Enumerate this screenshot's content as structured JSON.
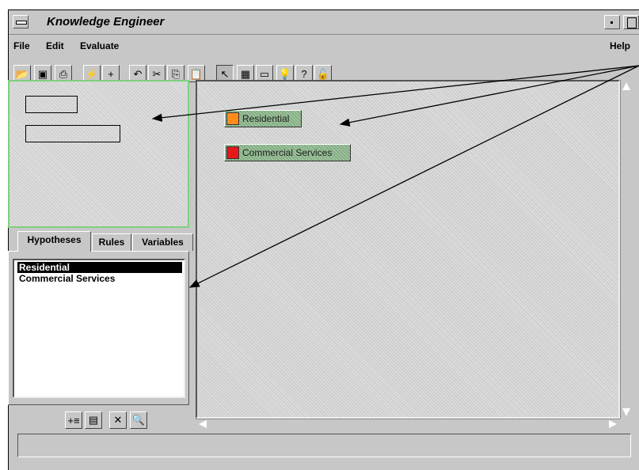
{
  "window": {
    "title": "Knowledge Engineer"
  },
  "menubar": {
    "file": "File",
    "edit": "Edit",
    "evaluate": "Evaluate",
    "help": "Help"
  },
  "toolbar": {
    "buttons": [
      {
        "name": "open-icon",
        "glyph": "📂"
      },
      {
        "name": "save-icon",
        "glyph": "▣"
      },
      {
        "name": "print-icon",
        "glyph": "⎙"
      },
      {
        "name": "connect-icon",
        "glyph": "⚡"
      },
      {
        "name": "add-icon",
        "glyph": "+"
      },
      {
        "name": "undo-icon",
        "glyph": "↶"
      },
      {
        "name": "cut-icon",
        "glyph": "✂"
      },
      {
        "name": "copy-icon",
        "glyph": "⎘"
      },
      {
        "name": "paste-icon",
        "glyph": "📋"
      },
      {
        "name": "select-pointer-icon",
        "glyph": "↖"
      },
      {
        "name": "legend-icon",
        "glyph": "▦"
      },
      {
        "name": "ruler-icon",
        "glyph": "▭"
      },
      {
        "name": "lightbulb-icon",
        "glyph": "💡"
      },
      {
        "name": "lightbulb-question-icon",
        "glyph": "?"
      },
      {
        "name": "unlock-icon",
        "glyph": "🔓"
      }
    ]
  },
  "tabs": {
    "hypotheses": "Hypotheses",
    "rules": "Rules",
    "variables": "Variables"
  },
  "hypotheses_list": [
    {
      "label": "Residential",
      "selected": true
    },
    {
      "label": "Commercial Services",
      "selected": false
    }
  ],
  "canvas_nodes": [
    {
      "label": "Residential",
      "color": "#ff8c1a"
    },
    {
      "label": "Commercial Services",
      "color": "#e41a1a"
    }
  ],
  "bottom_buttons": [
    {
      "name": "add-hypothesis-icon",
      "glyph": "+≡"
    },
    {
      "name": "edit-properties-icon",
      "glyph": "▤"
    },
    {
      "name": "delete-icon",
      "glyph": "✕"
    },
    {
      "name": "find-icon",
      "glyph": "🔍"
    }
  ],
  "status": {
    "text": ""
  }
}
